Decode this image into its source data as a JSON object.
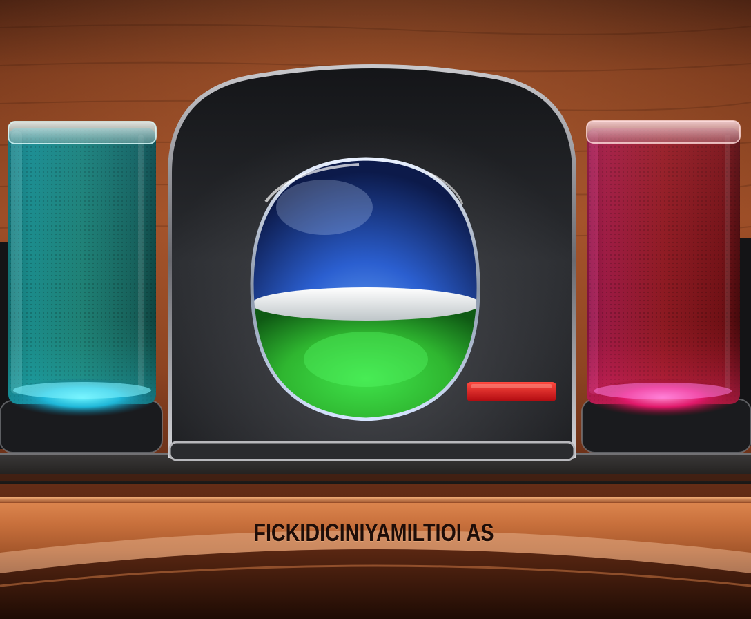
{
  "caption": {
    "text": "FICKIDICINIYAMILTIOI AS"
  },
  "colors": {
    "wood_dark": "#5e2a14",
    "wood_mid": "#a4542c",
    "panel_dark": "#1c1d20",
    "left_liquid": "#1fb7c8",
    "center_liquid": "#43c23a",
    "right_liquid": "#c0152a",
    "indicator": "#e0151c"
  },
  "icons": [
    "left-glass-cylinder",
    "center-glass-orb",
    "right-glass-cylinder",
    "red-indicator-bar"
  ]
}
